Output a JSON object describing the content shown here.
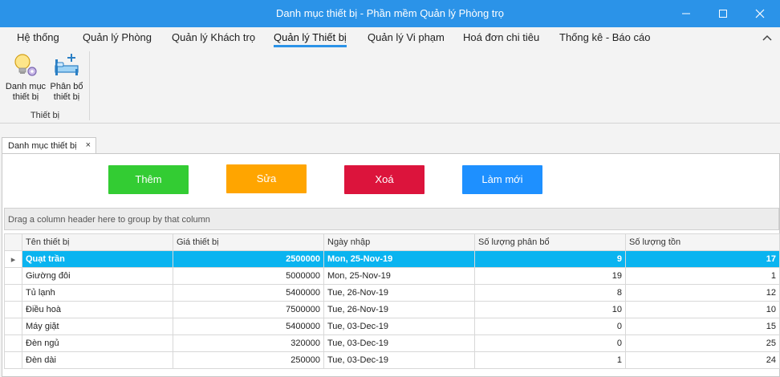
{
  "window": {
    "title": "Danh mục thiết bị - Phần mềm Quản lý Phòng trọ"
  },
  "menu": {
    "items": [
      "Hệ thống",
      "Quản lý Phòng",
      "Quản lý Khách trọ",
      "Quản lý Thiết bị",
      "Quản lý Vi phạm",
      "Hoá đơn chi tiêu",
      "Thống kê - Báo cáo"
    ],
    "active": "Quản lý Thiết bị"
  },
  "ribbon": {
    "buttons": [
      {
        "label1": "Danh mục",
        "label2": "thiết bị",
        "icon": "lightbulb-gear-icon"
      },
      {
        "label1": "Phân bổ",
        "label2": "thiết bị",
        "icon": "bed-plus-icon"
      }
    ],
    "group_label": "Thiết bị"
  },
  "tab": {
    "label": "Danh mục thiết bị",
    "close": "×"
  },
  "actions": {
    "add": "Thêm",
    "edit": "Sửa",
    "delete": "Xoá",
    "refresh": "Làm mới",
    "colors": {
      "add": "#33cc33",
      "edit": "#ffa500",
      "delete": "#dc143c",
      "refresh": "#1e90ff"
    }
  },
  "grid": {
    "group_hint": "Drag a column header here to group by that column",
    "columns": [
      "Tên thiết bị",
      "Giá thiết bị",
      "Ngày nhập",
      "Số lượng phân bổ",
      "Số lượng tồn"
    ],
    "selected_indicator": "▸",
    "rows": [
      [
        "Quạt trần",
        "2500000",
        "Mon, 25-Nov-19",
        "9",
        "17"
      ],
      [
        "Giường đôi",
        "5000000",
        "Mon, 25-Nov-19",
        "19",
        "1"
      ],
      [
        "Tủ lạnh",
        "5400000",
        "Tue, 26-Nov-19",
        "8",
        "12"
      ],
      [
        "Điều hoà",
        "7500000",
        "Tue, 26-Nov-19",
        "10",
        "10"
      ],
      [
        "Máy giặt",
        "5400000",
        "Tue, 03-Dec-19",
        "0",
        "15"
      ],
      [
        "Đèn ngủ",
        "320000",
        "Tue, 03-Dec-19",
        "0",
        "25"
      ],
      [
        "Đèn dài",
        "250000",
        "Tue, 03-Dec-19",
        "1",
        "24"
      ]
    ]
  }
}
